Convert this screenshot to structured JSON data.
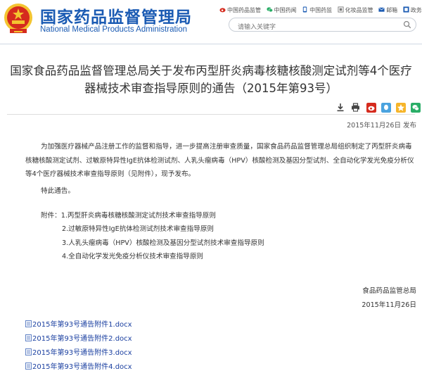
{
  "header": {
    "title": "国家药品监督管理局",
    "subtitle": "National Medical Products Administration",
    "links": [
      {
        "label": "中国药品监管",
        "icon": "weibo-icon",
        "color": "#d52b1e"
      },
      {
        "label": "中国药闻",
        "icon": "wechat-icon",
        "color": "#2aae67"
      },
      {
        "label": "中国药监",
        "icon": "app-icon",
        "color": "#1b5bb3"
      },
      {
        "label": "化妆品监管",
        "icon": "cosmetics-icon",
        "color": "#7a7a7a"
      },
      {
        "label": "邮箱",
        "icon": "mail-icon",
        "color": "#1b5bb3"
      },
      {
        "label": "政务",
        "icon": "gov-icon",
        "color": "#1b5bb3"
      }
    ],
    "search_placeholder": "请输入关键字"
  },
  "article": {
    "title_line1": "国家食品药品监督管理总局关于发布丙型肝炎病毒核糖核酸测定试剂等4个医疗",
    "title_line2": "器械技术审查指导原则的通告（2015年第93号）",
    "publish_date": "2015年11月26日 发布",
    "paragraph": "为加强医疗器械产品注册工作的监督和指导，进一步提高注册审查质量，国家食品药品监督管理总局组织制定了丙型肝炎病毒核糖核酸测定试剂、过敏原特异性IgE抗体检测试剂、人乳头瘤病毒（HPV）核酸检测及基因分型试剂、全自动化学发光免疫分析仪等4个医疗器械技术审查指导原则（见附件），现予发布。",
    "notice": "特此通告。",
    "attachments": [
      "附件：1.丙型肝炎病毒核糖核酸测定试剂技术审查指导原则",
      "2.过敏原特异性IgE抗体检测试剂技术审查指导原则",
      "3.人乳头瘤病毒（HPV）核酸检测及基因分型试剂技术审查指导原则",
      "4.全自动化学发光免疫分析仪技术审查指导原则"
    ],
    "signature_org": "食品药品监管总局",
    "signature_date": "2015年11月26日",
    "files": [
      "2015年第93号通告附件1.docx",
      "2015年第93号通告附件2.docx",
      "2015年第93号通告附件3.docx",
      "2015年第93号通告附件4.docx"
    ]
  },
  "colors": {
    "brand_blue": "#1b5bb3",
    "link_blue": "#1a3fa0",
    "emblem_red": "#d52b1e",
    "emblem_gold": "#f4c430"
  }
}
